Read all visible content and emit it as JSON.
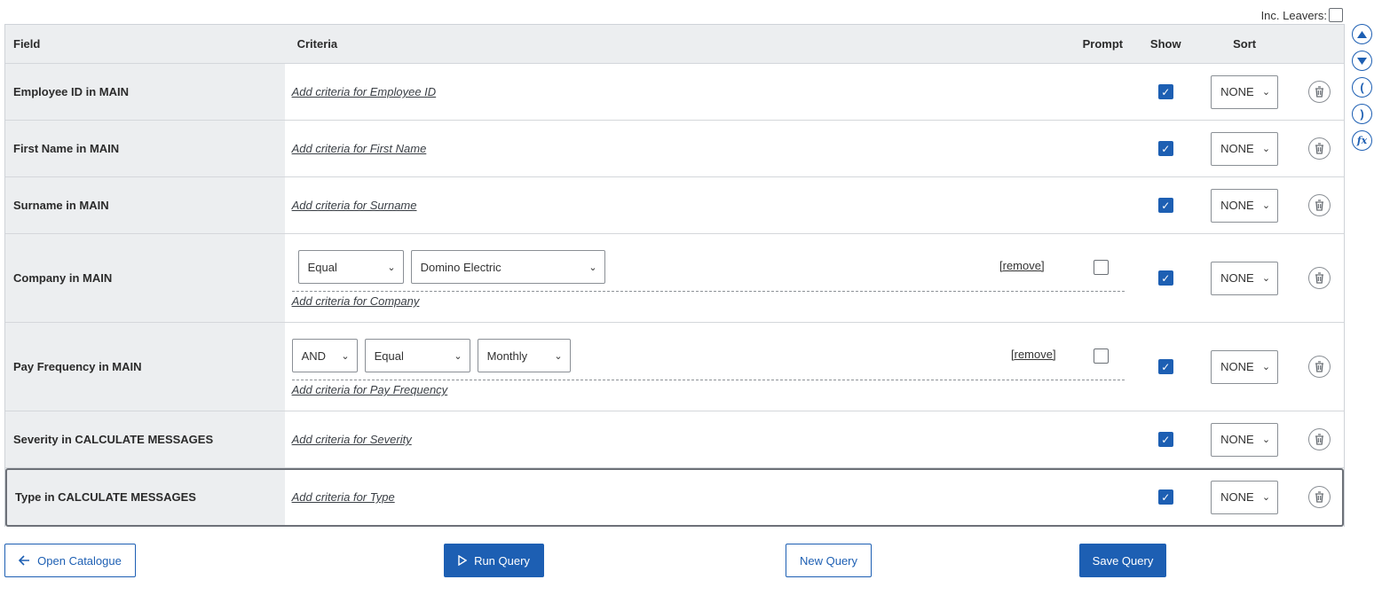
{
  "inc_leavers_label": "Inc. Leavers:",
  "headers": {
    "field": "Field",
    "criteria": "Criteria",
    "prompt": "Prompt",
    "show": "Show",
    "sort": "Sort"
  },
  "rows": [
    {
      "field": "Employee ID in MAIN",
      "add_link": "Add criteria for Employee ID",
      "show": true,
      "sort": "NONE"
    },
    {
      "field": "First Name in MAIN",
      "add_link": "Add criteria for First Name",
      "show": true,
      "sort": "NONE"
    },
    {
      "field": "Surname in MAIN",
      "add_link": "Add criteria for Surname",
      "show": true,
      "sort": "NONE"
    },
    {
      "field": "Company in MAIN",
      "operator": "Equal",
      "value": "Domino Electric",
      "remove": "[remove]",
      "prompt": false,
      "add_link": "Add criteria for Company",
      "show": true,
      "sort": "NONE"
    },
    {
      "field": "Pay Frequency in MAIN",
      "conjunction": "AND",
      "operator": "Equal",
      "value": "Monthly",
      "remove": "[remove]",
      "prompt": false,
      "add_link": "Add criteria for Pay Frequency",
      "show": true,
      "sort": "NONE"
    },
    {
      "field": "Severity in CALCULATE MESSAGES",
      "add_link": "Add criteria for Severity",
      "show": true,
      "sort": "NONE"
    },
    {
      "field": "Type in CALCULATE MESSAGES",
      "add_link": "Add criteria for Type",
      "show": true,
      "sort": "NONE"
    }
  ],
  "buttons": {
    "open_catalogue": "Open Catalogue",
    "run_query": "Run Query",
    "new_query": "New Query",
    "save_query": "Save Query"
  },
  "side_icons": [
    "move-up-icon",
    "move-down-icon",
    "open-bracket-icon",
    "close-bracket-icon",
    "function-icon"
  ],
  "colors": {
    "accent": "#1d5fb3",
    "field_bg": "#eceef0"
  }
}
